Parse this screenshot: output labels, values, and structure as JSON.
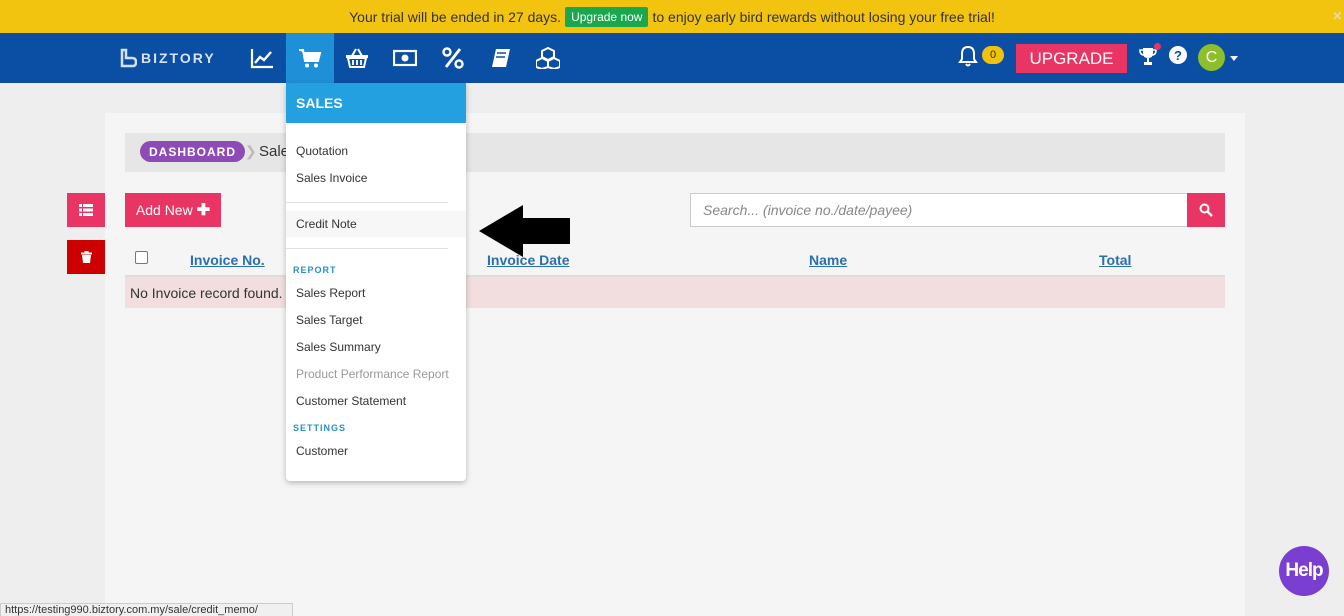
{
  "banner": {
    "text_before": "Your trial will be ended in 27 days.",
    "upgrade_now": "Upgrade now",
    "text_after": "to enjoy early bird rewards without losing your free trial!",
    "close": "×"
  },
  "nav": {
    "brand": "BIZTORY",
    "icons": [
      "chart-line-icon",
      "cart-icon",
      "basket-icon",
      "money-icon",
      "percent-icon",
      "book-icon",
      "cubes-icon"
    ],
    "active_icon": "cart-icon",
    "notification_count": "0",
    "upgrade_label": "UPGRADE",
    "help_glyph": "?",
    "avatar_initial": "C"
  },
  "breadcrumb": {
    "root": "DASHBOARD",
    "current": "Sale"
  },
  "toolbar": {
    "add_new": "Add New",
    "add_glyph": "✚",
    "search_placeholder": "Search... (invoice no./date/payee)"
  },
  "table": {
    "columns": [
      "Invoice No.",
      "Invoice Date",
      "Name",
      "Total"
    ],
    "empty_message": "No Invoice record found."
  },
  "dropdown": {
    "title": "SALES",
    "items_main": [
      "Quotation",
      "Sales Invoice"
    ],
    "item_credit": "Credit Note",
    "report_header": "REPORT",
    "report_items": [
      "Sales Report",
      "Sales Target",
      "Sales Summary",
      "Product Performance Report",
      "Customer Statement"
    ],
    "settings_header": "SETTINGS",
    "settings_items": [
      "Customer"
    ]
  },
  "status_url": "https://testing990.biztory.com.my/sale/credit_memo/",
  "help_label": "Help",
  "colors": {
    "banner": "#f2c40f",
    "nav": "#0b4fa5",
    "accent": "#e83563",
    "dropdown_header": "#22a0e0",
    "empty_row": "#f2dede"
  }
}
